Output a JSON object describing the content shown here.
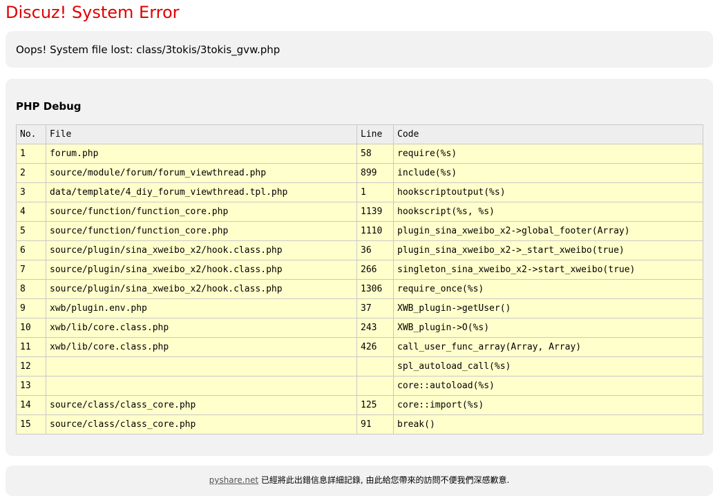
{
  "page": {
    "title": "Discuz! System Error",
    "message": "Oops! System file lost: class/3tokis/3tokis_gvw.php"
  },
  "debug": {
    "heading": "PHP Debug",
    "columns": {
      "no": "No.",
      "file": "File",
      "line": "Line",
      "code": "Code"
    },
    "rows": [
      {
        "no": "1",
        "file": "forum.php",
        "line": "58",
        "code": "require(%s)"
      },
      {
        "no": "2",
        "file": "source/module/forum/forum_viewthread.php",
        "line": "899",
        "code": "include(%s)"
      },
      {
        "no": "3",
        "file": "data/template/4_diy_forum_viewthread.tpl.php",
        "line": "1",
        "code": "hookscriptoutput(%s)"
      },
      {
        "no": "4",
        "file": "source/function/function_core.php",
        "line": "1139",
        "code": "hookscript(%s, %s)"
      },
      {
        "no": "5",
        "file": "source/function/function_core.php",
        "line": "1110",
        "code": "plugin_sina_xweibo_x2->global_footer(Array)"
      },
      {
        "no": "6",
        "file": "source/plugin/sina_xweibo_x2/hook.class.php",
        "line": "36",
        "code": "plugin_sina_xweibo_x2->_start_xweibo(true)"
      },
      {
        "no": "7",
        "file": "source/plugin/sina_xweibo_x2/hook.class.php",
        "line": "266",
        "code": "singleton_sina_xweibo_x2->start_xweibo(true)"
      },
      {
        "no": "8",
        "file": "source/plugin/sina_xweibo_x2/hook.class.php",
        "line": "1306",
        "code": "require_once(%s)"
      },
      {
        "no": "9",
        "file": "xwb/plugin.env.php",
        "line": "37",
        "code": "XWB_plugin->getUser()"
      },
      {
        "no": "10",
        "file": "xwb/lib/core.class.php",
        "line": "243",
        "code": "XWB_plugin->O(%s)"
      },
      {
        "no": "11",
        "file": "xwb/lib/core.class.php",
        "line": "426",
        "code": "call_user_func_array(Array, Array)"
      },
      {
        "no": "12",
        "file": "",
        "line": "",
        "code": "spl_autoload_call(%s)"
      },
      {
        "no": "13",
        "file": "",
        "line": "",
        "code": "core::autoload(%s)"
      },
      {
        "no": "14",
        "file": "source/class/class_core.php",
        "line": "125",
        "code": "core::import(%s)"
      },
      {
        "no": "15",
        "file": "source/class/class_core.php",
        "line": "91",
        "code": "break()"
      }
    ]
  },
  "footer": {
    "link_text": "pyshare.net",
    "text": " 已經將此出錯信息詳細記錄, 由此給您帶來的訪問不便我們深感歉意."
  },
  "colors": {
    "title": "#e00000",
    "box_background": "#f2f2f2",
    "row_background": "#ffffcc",
    "header_background": "#eeeeee"
  }
}
